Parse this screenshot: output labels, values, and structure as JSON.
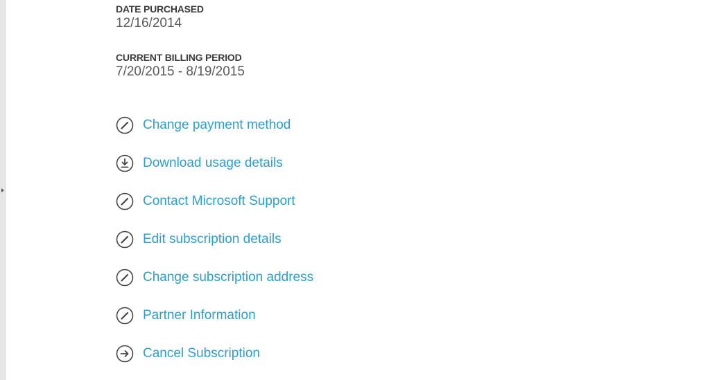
{
  "details": {
    "date_purchased": {
      "label": "DATE PURCHASED",
      "value": "12/16/2014"
    },
    "billing_period": {
      "label": "CURRENT BILLING PERIOD",
      "value": "7/20/2015 - 8/19/2015"
    }
  },
  "actions": [
    {
      "label": "Change payment method",
      "icon": "edit-icon"
    },
    {
      "label": "Download usage details",
      "icon": "download-icon"
    },
    {
      "label": "Contact Microsoft Support",
      "icon": "edit-icon"
    },
    {
      "label": "Edit subscription details",
      "icon": "edit-icon"
    },
    {
      "label": "Change subscription address",
      "icon": "edit-icon"
    },
    {
      "label": "Partner Information",
      "icon": "edit-icon"
    },
    {
      "label": "Cancel Subscription",
      "icon": "arrow-right-icon"
    }
  ],
  "colors": {
    "link": "#2b9fcf",
    "label": "#3a3a3a",
    "value": "#5a5a5a",
    "icon": "#444444"
  }
}
